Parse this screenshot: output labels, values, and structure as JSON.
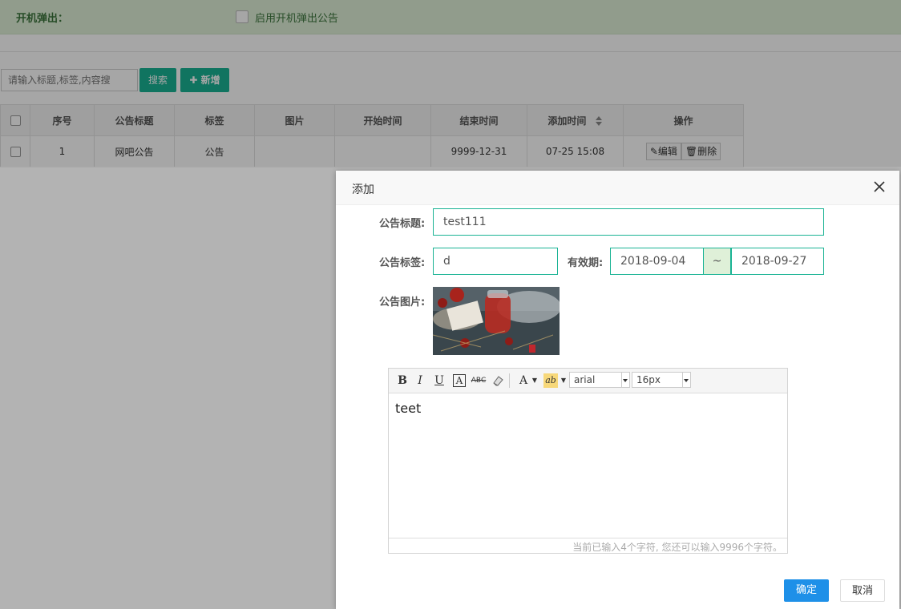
{
  "topbar": {
    "label": "开机弹出：",
    "checkbox_text": "启用开机弹出公告"
  },
  "search": {
    "placeholder": "请输入标题,标签,内容搜",
    "button": "搜索",
    "add_button": "新增",
    "add_icon": "plus-icon"
  },
  "table": {
    "headers": [
      "序号",
      "公告标题",
      "标签",
      "图片",
      "开始时间",
      "结束时间",
      "添加时间",
      "操作"
    ],
    "rows": [
      {
        "no": "1",
        "title": "网吧公告",
        "tag": "公告",
        "image": "",
        "start": "",
        "end": "9999-12-31",
        "added": "07-25 15:08"
      }
    ],
    "edit_label": "编辑",
    "delete_label": "删除"
  },
  "modal": {
    "title": "添加",
    "title_label": "公告标题:",
    "title_value": "test111",
    "tag_label": "公告标签:",
    "tag_value": "d",
    "valid_label": "有效期:",
    "start_date": "2018-09-04",
    "tilde": "~",
    "end_date": "2018-09-27",
    "image_label": "公告图片:",
    "editor": {
      "toolbar": {
        "bold": "B",
        "italic": "I",
        "underline": "U",
        "fontborder": "A",
        "strike": "ABC",
        "forecolor": "A",
        "backcolor": "ab",
        "font_family": "arial",
        "font_size": "16px"
      },
      "content": "teet",
      "count_text": "当前已输入4个字符, 您还可以输入9996个字符。"
    },
    "ok_button": "确定",
    "cancel_button": "取消"
  },
  "colors": {
    "accent_green": "#1ab394",
    "topbar_bg": "#dff0d8",
    "primary_blue": "#1e90e8"
  }
}
